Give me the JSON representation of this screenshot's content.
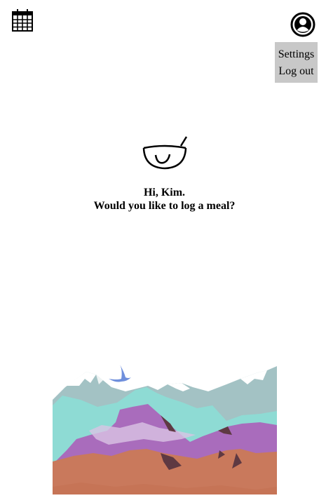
{
  "header": {
    "calendar_icon": "calendar-icon",
    "profile_icon": "user-avatar-icon"
  },
  "menu": {
    "items": [
      {
        "label": "Settings"
      },
      {
        "label": "Log out"
      }
    ]
  },
  "main": {
    "meal_icon": "bowl-with-spoon-icon",
    "greeting_line1": "Hi, Kim.",
    "greeting_line2": "Would you like to log a meal?"
  },
  "illustration": {
    "description_icon": "mountain-landscape-illustration",
    "colors": {
      "snow_peaks": "#a3c2c4",
      "teal_hills": "#8edbd4",
      "purple_mountains": "#a96cbc",
      "terracotta_ground": "#c9795c",
      "dark_shadows": "#5e3942",
      "bird": "#6f8fdc"
    }
  }
}
